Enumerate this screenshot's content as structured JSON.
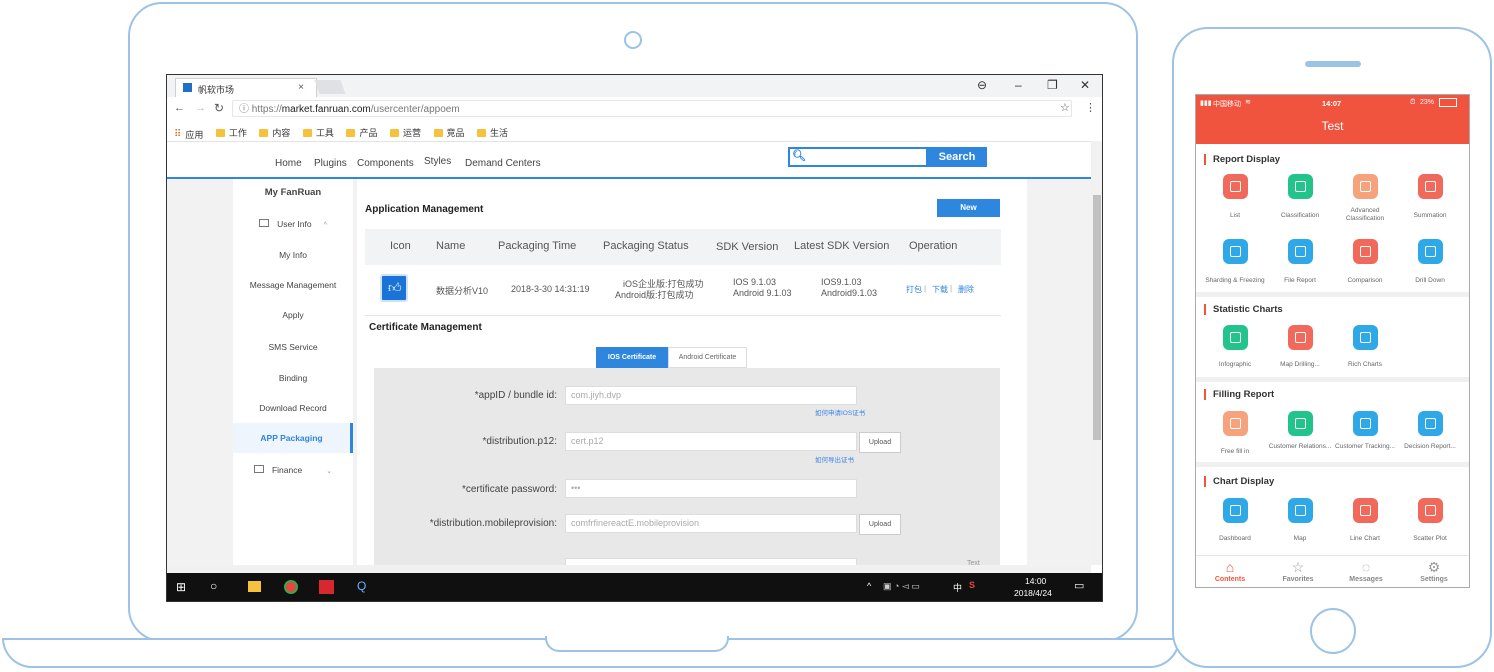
{
  "browser": {
    "tab_title": "帆软市场",
    "tab_close": "×",
    "url_prefix": "https://",
    "url_domain": "market.fanruan.com",
    "url_path": "/usercenter/appoem",
    "bookmarks": [
      "应用",
      "工作",
      "内容",
      "工具",
      "产品",
      "运营",
      "竞品",
      "生活"
    ]
  },
  "site_nav": {
    "items": [
      "Home",
      "Plugins",
      "Components",
      "Styles",
      "Demand Centers"
    ],
    "search_button": "Search"
  },
  "sidebar": {
    "title": "My FanRuan",
    "items": [
      "User Info",
      "My Info",
      "Message Management",
      "Apply",
      "SMS Service",
      "Binding",
      "Download Record",
      "APP Packaging",
      "Finance"
    ],
    "active": "APP Packaging"
  },
  "app_mgmt": {
    "title": "Application Management",
    "new_button": "New",
    "headers": [
      "Icon",
      "Name",
      "Packaging Time",
      "Packaging Status",
      "SDK Version",
      "Latest SDK Version",
      "Operation"
    ],
    "row": {
      "name": "数据分析V10",
      "time": "2018-3-30 14:31:19",
      "status_ios": "iOS企业版:打包成功",
      "status_android": "Android版:打包成功",
      "sdk_ios": "IOS 9.1.03",
      "sdk_android": "Android 9.1.03",
      "latest_ios": "IOS9.1.03",
      "latest_android": "Android9.1.03",
      "op_pack": "打包",
      "op_download": "下载",
      "op_delete": "删除",
      "sep": "|"
    }
  },
  "cert_mgmt": {
    "title": "Certificate Management",
    "tab_ios": "IOS Certificate",
    "tab_android": "Android Certificate",
    "fields": {
      "appid_label": "*appID / bundle id:",
      "appid_value": "com.jiyh.dvp",
      "appid_hint": "如何申请IOS证书",
      "p12_label": "*distribution.p12:",
      "p12_value": "cert.p12",
      "p12_hint": "如何导出证书",
      "pwd_label": "*certificate password:",
      "pwd_value": "•••",
      "prov_label": "*distribution.mobileprovision:",
      "prov_value": "comfrfinereactE.mobileprovision",
      "upload": "Upload"
    },
    "tail_text": "Text"
  },
  "taskbar": {
    "time": "14:00",
    "date": "2018/4/24",
    "ime": "中"
  },
  "phone": {
    "carrier": "中国移动",
    "time": "14:07",
    "battery": "23%",
    "title": "Test",
    "sections": {
      "report_display": {
        "title": "Report Display",
        "items": [
          "List",
          "Classification",
          "Advanced Classification",
          "Summation",
          "Sharding & Freezing",
          "File Report",
          "Comparison",
          "Drill Down"
        ]
      },
      "statistic_charts": {
        "title": "Statistic Charts",
        "items": [
          "Infographic",
          "Map Drilling...",
          "Rich Charts"
        ]
      },
      "filling_report": {
        "title": "Filling Report",
        "items": [
          "Free fill in",
          "Customer Relations...",
          "Customer Tracking...",
          "Decision Report..."
        ]
      },
      "chart_display": {
        "title": "Chart Display",
        "items": [
          "Dashboard",
          "Map",
          "Line Chart",
          "Scatter Plot"
        ]
      }
    },
    "tabbar": [
      "Contents",
      "Favorites",
      "Messages",
      "Settings"
    ]
  },
  "colors": {
    "accent_blue": "#2e86de",
    "phone_red": "#f0543f",
    "frame_blue": "#9cc3e6"
  }
}
